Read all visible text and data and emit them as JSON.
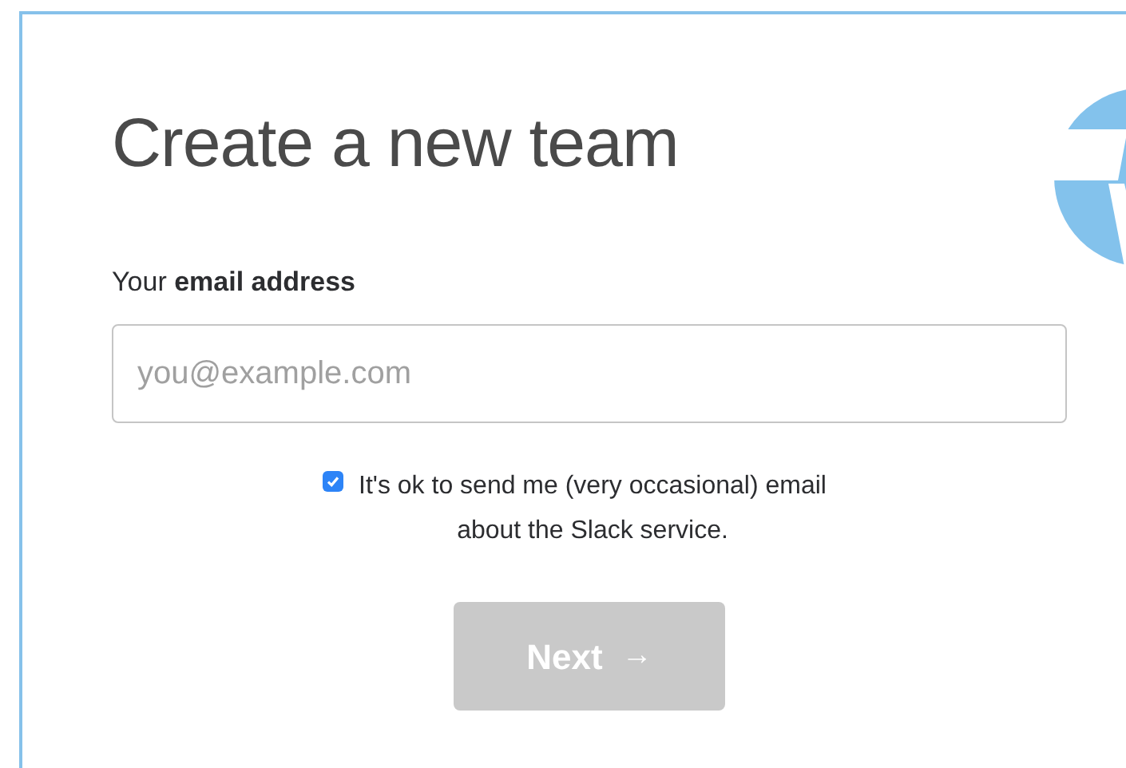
{
  "title": "Create a new team",
  "email": {
    "label": "Your **email address**",
    "placeholder": "you@example.com"
  },
  "consent": {
    "checked": true,
    "text": "It's ok to send me (very occasional) email about the Slack service."
  },
  "next_button": {
    "label": "Next",
    "arrow": "→",
    "disabled": true
  }
}
